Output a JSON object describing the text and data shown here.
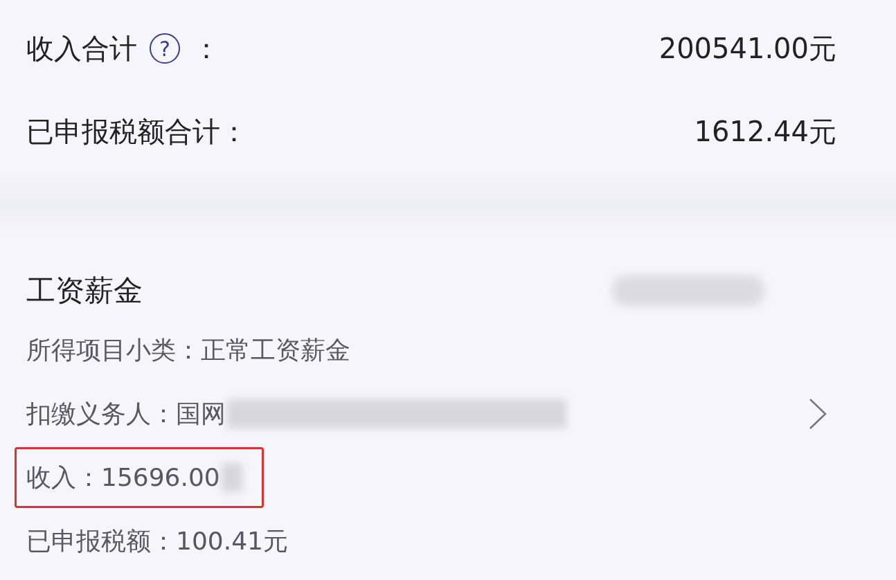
{
  "summary": [
    {
      "label": "收入合计",
      "help": "?",
      "separator": "：",
      "value": "200541.00元"
    },
    {
      "label": "已申报税额合计：",
      "value": "1612.44元"
    }
  ],
  "section": {
    "title": "工资薪金",
    "redacted": true,
    "details": [
      {
        "text": "所得项目小类：正常工资薪金",
        "redacted": false,
        "highlighted": false,
        "chevron": false
      },
      {
        "text": "扣缴义务人：国网",
        "redacted": true,
        "highlighted": false,
        "chevron": true
      },
      {
        "text": "收入：15696.00",
        "redacted": true,
        "highlighted": true,
        "chevron": false
      },
      {
        "text": "已申报税额：100.41元",
        "redacted": false,
        "highlighted": false,
        "chevron": false
      }
    ]
  }
}
